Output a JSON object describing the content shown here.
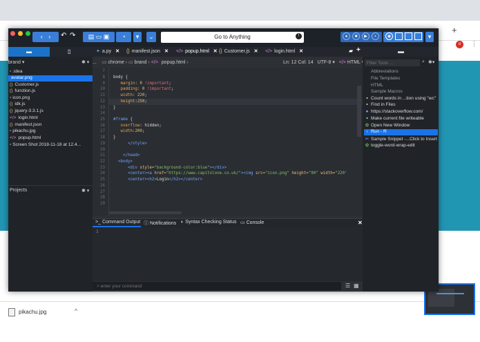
{
  "browser": {
    "add_tab": "+",
    "avatar_letter": "o",
    "menu_icon": "⋮",
    "download": {
      "filename": "pikachu.jpg",
      "chevron": "^"
    }
  },
  "toolbar": {
    "goto_placeholder": "Go to Anything",
    "back_icon": "‹",
    "forward_icon": "›",
    "undo_icon": "↶",
    "redo_icon": "↷",
    "dropdown_icon": "▾",
    "chevron_icon": "⌄"
  },
  "tabs": [
    {
      "label": "a.py",
      "icon": "py"
    },
    {
      "label": "manifest.json",
      "icon": "json"
    },
    {
      "label": "popup.html",
      "icon": "html",
      "active": true
    },
    {
      "label": "Customer.js",
      "icon": "js"
    },
    {
      "label": "login.html",
      "icon": "html"
    }
  ],
  "sidebar": {
    "header": "brand ▾",
    "gear": "✱ ▾",
    "items": [
      {
        "label": ".idea",
        "icon": "folder"
      },
      {
        "label": "avatar.png",
        "icon": "file",
        "selected": true
      },
      {
        "label": "Customer.js",
        "icon": "js"
      },
      {
        "label": "function.js",
        "icon": "js"
      },
      {
        "label": "icon.png",
        "icon": "file"
      },
      {
        "label": "idk.js",
        "icon": "js"
      },
      {
        "label": "jquery-3.3.1.js",
        "icon": "js"
      },
      {
        "label": "login.html",
        "icon": "html"
      },
      {
        "label": "manifest.json",
        "icon": "js"
      },
      {
        "label": "pikachu.jpg",
        "icon": "file"
      },
      {
        "label": "popup.html",
        "icon": "html"
      },
      {
        "label": "Screen Shot 2018-11-18 at 12.4...",
        "icon": "file"
      }
    ],
    "projects_label": "Projects",
    "projects_gear": "✱ ▾"
  },
  "pathbar": {
    "dots": "...",
    "crumbs": [
      "chrome",
      "brand",
      "popup.html"
    ],
    "position": "Ln: 12 Col: 14",
    "encoding": "UTF-8 ▾",
    "language": "HTML ▾"
  },
  "code": {
    "line_numbers": [
      "7",
      "8",
      "9",
      "10",
      "11",
      "12",
      "13",
      "14",
      "15",
      "16",
      "17",
      "18",
      "19",
      "20",
      "21",
      "22",
      "23",
      "24",
      "25",
      "26",
      "27",
      "28",
      "29"
    ]
  },
  "bottom_panel": {
    "tabs": [
      "Command Output",
      "Notifications",
      "Syntax Checking Status",
      "Console"
    ],
    "close": "✕",
    "line": "1",
    "cmd_placeholder": "> enter your command"
  },
  "toolbox": {
    "filter_placeholder": "Filter Tools ...",
    "items": [
      {
        "label": "Abbreviations",
        "kind": "folder"
      },
      {
        "label": "File Templates",
        "kind": "folder"
      },
      {
        "label": "HTML",
        "kind": "folder"
      },
      {
        "label": "Sample Macros",
        "kind": "folder"
      },
      {
        "label": "Count words in ...tion using \"wc\"",
        "kind": "cmd"
      },
      {
        "label": "Find in Files",
        "kind": "cmd"
      },
      {
        "label": "https://stackoverflow.com/",
        "kind": "url"
      },
      {
        "label": "Make current file writeable",
        "kind": "cmd"
      },
      {
        "label": "Open New Window",
        "kind": "macro"
      },
      {
        "label": "Run - R",
        "kind": "run",
        "selected": true
      },
      {
        "label": "Sample Snippet -...Click to Insert",
        "kind": "snippet"
      },
      {
        "label": "toggle-word-wrap-edit",
        "kind": "macro"
      }
    ]
  }
}
